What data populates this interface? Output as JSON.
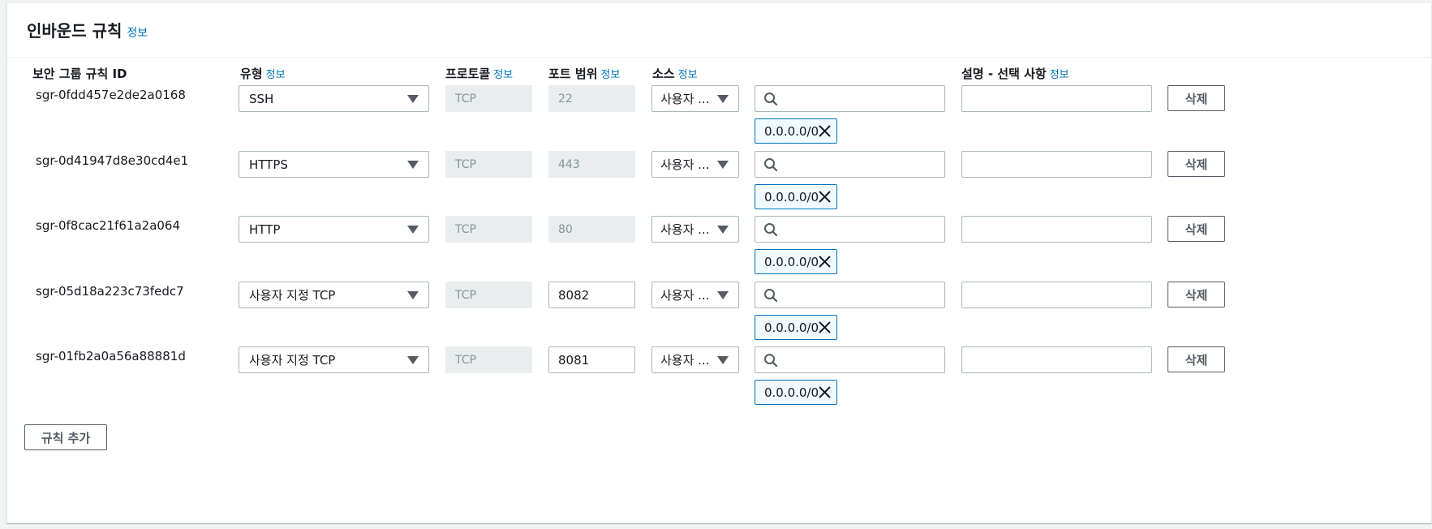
{
  "panel": {
    "title": "인바운드 규칙",
    "info": "정보"
  },
  "columns": {
    "rule_id": "보안 그룹 규칙 ID",
    "type": "유형",
    "protocol": "프로토콜",
    "port_range": "포트 범위",
    "source": "소스",
    "description": "설명 - 선택 사항",
    "info": "정보"
  },
  "rules": [
    {
      "id": "sgr-0fdd457e2de2a0168",
      "type": "SSH",
      "protocol": "TCP",
      "port": "22",
      "port_editable": false,
      "source_type": "사용자 ...",
      "source_search": "",
      "cidr": "0.0.0.0/0",
      "description": "",
      "delete_label": "삭제"
    },
    {
      "id": "sgr-0d41947d8e30cd4e1",
      "type": "HTTPS",
      "protocol": "TCP",
      "port": "443",
      "port_editable": false,
      "source_type": "사용자 ...",
      "source_search": "",
      "cidr": "0.0.0.0/0",
      "description": "",
      "delete_label": "삭제"
    },
    {
      "id": "sgr-0f8cac21f61a2a064",
      "type": "HTTP",
      "protocol": "TCP",
      "port": "80",
      "port_editable": false,
      "source_type": "사용자 ...",
      "source_search": "",
      "cidr": "0.0.0.0/0",
      "description": "",
      "delete_label": "삭제"
    },
    {
      "id": "sgr-05d18a223c73fedc7",
      "type": "사용자 지정 TCP",
      "protocol": "TCP",
      "port": "8082",
      "port_editable": true,
      "source_type": "사용자 ...",
      "source_search": "",
      "cidr": "0.0.0.0/0",
      "description": "",
      "delete_label": "삭제"
    },
    {
      "id": "sgr-01fb2a0a56a88881d",
      "type": "사용자 지정 TCP",
      "protocol": "TCP",
      "port": "8081",
      "port_editable": true,
      "source_type": "사용자 ...",
      "source_search": "",
      "cidr": "0.0.0.0/0",
      "description": "",
      "delete_label": "삭제"
    }
  ],
  "add_rule_label": "규칙 추가",
  "colors": {
    "link": "#0073bb",
    "token_border": "#0073bb",
    "token_bg": "#f1faff",
    "disabled_bg": "#eaeded",
    "button_border": "#545b64"
  }
}
